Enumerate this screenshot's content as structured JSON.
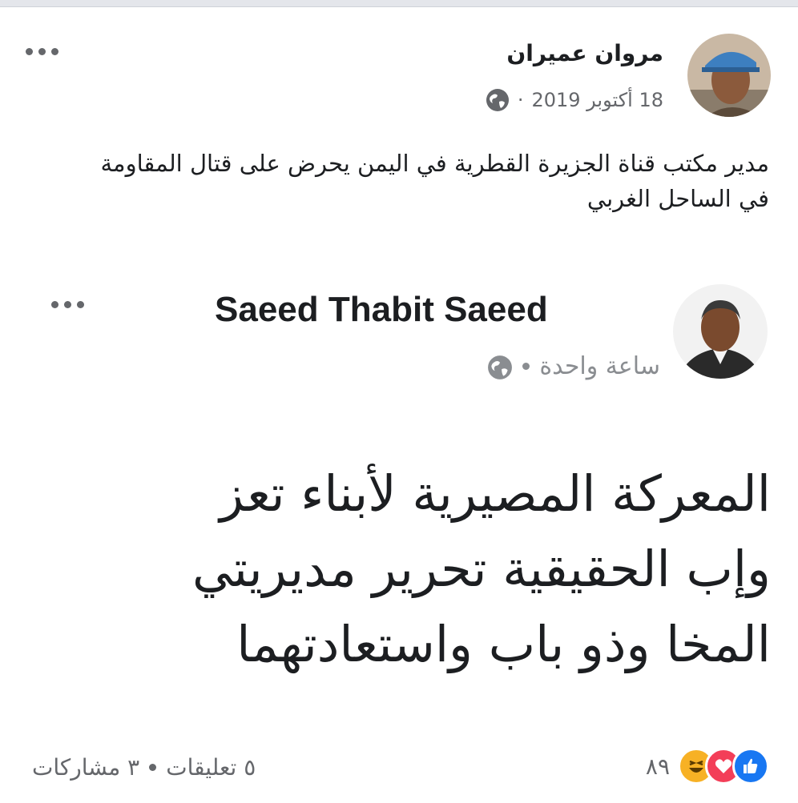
{
  "post": {
    "author": "مروان عميران",
    "date": "18 أكتوبر 2019",
    "separator": "·",
    "privacy_icon": "globe-icon",
    "text": "مدير مكتب قناة الجزيرة القطرية في اليمن يحرض على قتال المقاومة في الساحل الغربي"
  },
  "shared_post": {
    "author": "Saeed Thabit Saeed",
    "time": "ساعة واحدة",
    "privacy_icon": "globe-icon",
    "text_lines": [
      "المعركة المصيرية لأبناء تعز",
      "وإب الحقيقية تحرير مديريتي",
      "المخا وذو باب واستعادتهما"
    ]
  },
  "footer": {
    "reactions_count": "٨٩",
    "reaction_icons": [
      "like-icon",
      "love-icon",
      "haha-icon"
    ],
    "comments": "٥ تعليقات",
    "shares": "٣ مشاركات"
  },
  "colors": {
    "like": "#1877f2",
    "love": "#f33e58",
    "haha": "#f7b125",
    "meta_text": "#65676b"
  }
}
